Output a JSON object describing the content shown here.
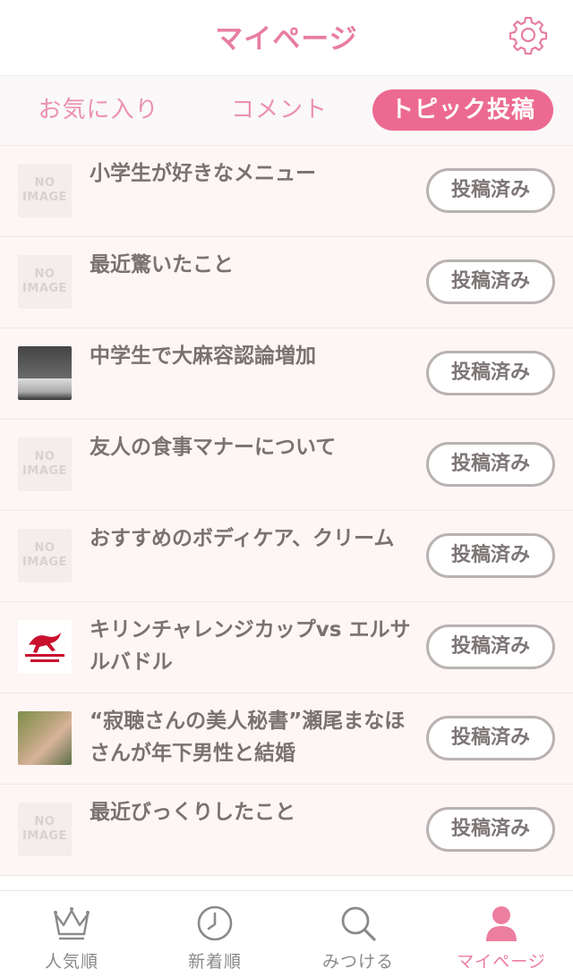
{
  "header": {
    "title": "マイページ",
    "settings_icon": "gear-icon"
  },
  "tabs": [
    {
      "label": "お気に入り",
      "active": false
    },
    {
      "label": "コメント",
      "active": false
    },
    {
      "label": "トピック投稿",
      "active": true
    }
  ],
  "no_image_text": "NO IMAGE",
  "topics": [
    {
      "title": "小学生が好きなメニュー",
      "status": "投稿済み",
      "thumbnail": "no-image"
    },
    {
      "title": "最近驚いたこと",
      "status": "投稿済み",
      "thumbnail": "no-image"
    },
    {
      "title": "中学生で大麻容認論増加",
      "status": "投稿済み",
      "thumbnail": "photo"
    },
    {
      "title": "友人の食事マナーについて",
      "status": "投稿済み",
      "thumbnail": "no-image"
    },
    {
      "title": "おすすめのボディケア、クリーム",
      "status": "投稿済み",
      "thumbnail": "no-image"
    },
    {
      "title": "キリンチャレンジカップvs エルサルバドル",
      "status": "投稿済み",
      "thumbnail": "kirin-challenge-cup-logo"
    },
    {
      "title": "“寂聴さんの美人秘書”瀬尾まなほさんが年下男性と結婚",
      "status": "投稿済み",
      "thumbnail": "photo"
    },
    {
      "title": "最近びっくりしたこと",
      "status": "投稿済み",
      "thumbnail": "no-image"
    }
  ],
  "bottom_nav": [
    {
      "label": "人気順",
      "icon": "crown-icon",
      "active": false
    },
    {
      "label": "新着順",
      "icon": "clock-icon",
      "active": false
    },
    {
      "label": "みつける",
      "icon": "search-icon",
      "active": false
    },
    {
      "label": "マイページ",
      "icon": "person-icon",
      "active": true
    }
  ],
  "colors": {
    "accent": "#ec6a91",
    "accent_light": "#e87ea0",
    "row_background": "#fdf6f5",
    "button_border": "#b9b2b2",
    "text_dark": "#7a7272",
    "nav_inactive": "#8a8a8a"
  }
}
